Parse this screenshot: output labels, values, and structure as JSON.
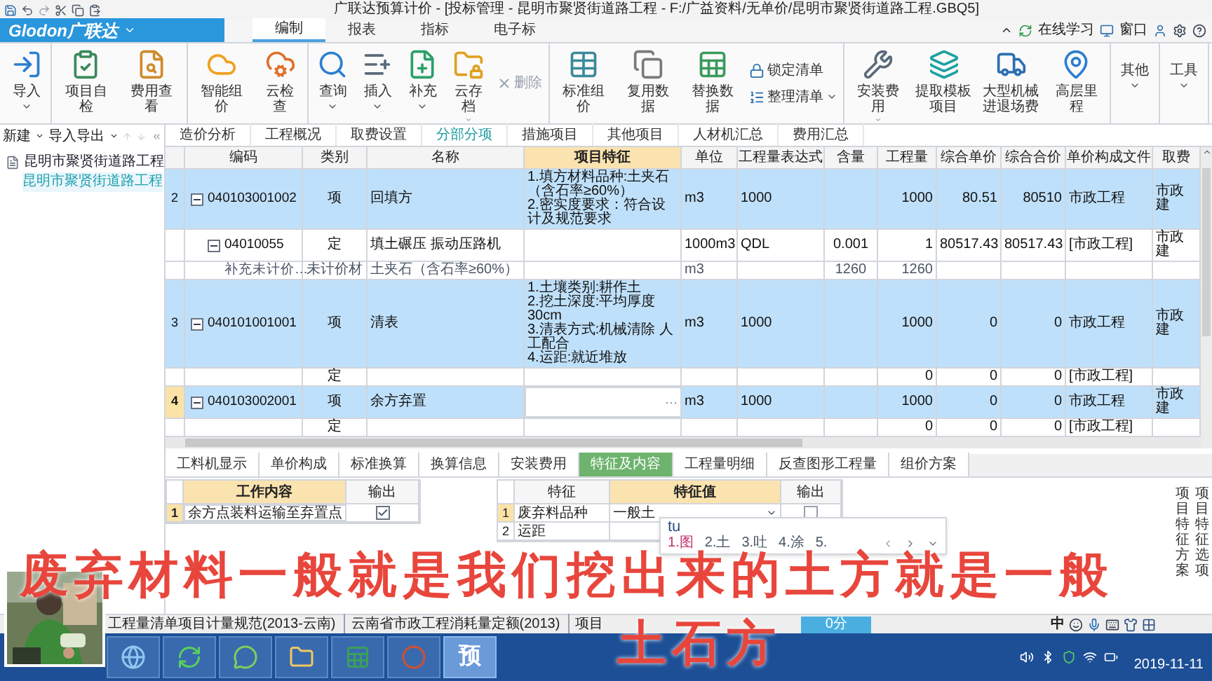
{
  "window": {
    "title": "广联达预算计价 - [投标管理 - 昆明市聚贤街道路工程 - F:/广益资料/无单价/昆明市聚贤街道路工程.GBQ5]"
  },
  "app_menu": {
    "label": "Glodon广联达"
  },
  "ribbon_tabs": [
    {
      "label": "编制",
      "selected": true
    },
    {
      "label": "报表",
      "selected": false
    },
    {
      "label": "指标",
      "selected": false
    },
    {
      "label": "电子标",
      "selected": false
    }
  ],
  "ribbon_links": [
    "在线学习",
    "窗口"
  ],
  "toolbar": [
    {
      "items": [
        {
          "label": "导入",
          "kind": "large",
          "menu": true,
          "disabled": false
        }
      ]
    },
    {
      "items": [
        {
          "label": "项目自检",
          "kind": "large",
          "menu": false,
          "disabled": false
        },
        {
          "label": "费用查看",
          "kind": "large",
          "menu": false,
          "disabled": false
        }
      ]
    },
    {
      "items": [
        {
          "label": "智能组价",
          "kind": "large",
          "menu": false,
          "disabled": false
        },
        {
          "label": "云检查",
          "kind": "large",
          "menu": false,
          "disabled": false
        }
      ]
    },
    {
      "items": [
        {
          "label": "查询",
          "kind": "large",
          "menu": true,
          "disabled": false
        },
        {
          "label": "插入",
          "kind": "large",
          "menu": true,
          "disabled": false
        },
        {
          "label": "补充",
          "kind": "large",
          "menu": true,
          "disabled": false
        },
        {
          "label": "云存档",
          "kind": "large",
          "menu": true,
          "disabled": false
        },
        {
          "label": "删除",
          "kind": "small",
          "menu": false,
          "disabled": true
        }
      ]
    },
    {
      "items": [
        {
          "label": "标准组价",
          "kind": "large",
          "menu": false,
          "disabled": false
        },
        {
          "label": "复用数据",
          "kind": "large",
          "menu": false,
          "disabled": false
        },
        {
          "label": "替换数据",
          "kind": "large",
          "menu": false,
          "disabled": false
        },
        {
          "label": "锁定清单",
          "kind": "small",
          "menu": false,
          "disabled": false
        },
        {
          "label": "整理清单",
          "kind": "small",
          "menu": true,
          "disabled": false
        }
      ]
    },
    {
      "items": [
        {
          "label": "安装费用",
          "kind": "large",
          "menu": true,
          "disabled": false
        },
        {
          "label": "提取模板项目",
          "kind": "large",
          "menu": false,
          "disabled": false
        },
        {
          "label": "大型机械进退场费",
          "kind": "large",
          "menu": false,
          "disabled": false
        },
        {
          "label": "高层里程",
          "kind": "large",
          "menu": false,
          "disabled": false
        }
      ]
    },
    {
      "items": [
        {
          "label": "其他",
          "kind": "large",
          "menu": true,
          "disabled": false
        }
      ]
    },
    {
      "items": [
        {
          "label": "工具",
          "kind": "large",
          "menu": true,
          "disabled": false
        }
      ]
    }
  ],
  "left_panel": {
    "actions": [
      "新建",
      "导入导出"
    ],
    "tree": [
      {
        "label": "昆明市聚贤街道路工程",
        "selected": false,
        "children": [
          {
            "label": "昆明市聚贤街道路工程",
            "selected": true
          }
        ]
      }
    ]
  },
  "view_tabs": [
    {
      "label": "造价分析",
      "selected": false
    },
    {
      "label": "工程概况",
      "selected": false
    },
    {
      "label": "取费设置",
      "selected": false
    },
    {
      "label": "分部分项",
      "selected": true
    },
    {
      "label": "措施项目",
      "selected": false
    },
    {
      "label": "其他项目",
      "selected": false
    },
    {
      "label": "人材机汇总",
      "selected": false
    },
    {
      "label": "费用汇总",
      "selected": false
    }
  ],
  "grid": {
    "columns": [
      {
        "label": "编码",
        "current": false
      },
      {
        "label": "类别",
        "current": false
      },
      {
        "label": "名称",
        "current": false
      },
      {
        "label": "项目特征",
        "current": true
      },
      {
        "label": "单位",
        "current": false
      },
      {
        "label": "工程量表达式",
        "current": false
      },
      {
        "label": "含量",
        "current": false
      },
      {
        "label": "工程量",
        "current": false
      },
      {
        "label": "综合单价",
        "current": false
      },
      {
        "label": "综合合价",
        "current": false
      },
      {
        "label": "单价构成文件",
        "current": false
      },
      {
        "label": "取费",
        "current": false
      }
    ],
    "rows": [
      {
        "kind": "item",
        "row_number": "2",
        "selected": false,
        "expanded": true,
        "code": "040103001002",
        "type": "项",
        "name": "回填方",
        "feature": "1.填方材料品种:土夹石（含石率≥60%）\n2.密实度要求：符合设计及规范要求",
        "unit": "m3",
        "expr": "1000",
        "qty": "1000",
        "unit_price": "80.51",
        "total": "80510",
        "template": "市政工程",
        "fee": "市政建"
      },
      {
        "kind": "quota",
        "selected": false,
        "expanded": true,
        "code": "04010055",
        "type": "定",
        "name": "填土碾压 振动压路机",
        "unit": "1000m3",
        "expr": "QDL",
        "content": "0.001",
        "qty": "1",
        "unit_price": "80517.43",
        "total": "80517.43",
        "template": "[市政工程]",
        "fee": "市政建"
      },
      {
        "kind": "material",
        "selected": false,
        "code": "补充未计价…",
        "type": "未计价材",
        "name": "土夹石（含石率≥60%）",
        "unit": "m3",
        "content": "1260",
        "qty": "1260"
      },
      {
        "kind": "item",
        "row_number": "3",
        "selected": false,
        "expanded": true,
        "code": "040101001001",
        "type": "项",
        "name": "清表",
        "feature": "1.土壤类别:耕作土\n2.挖土深度:平均厚度30cm\n3.清表方式:机械清除 人工配合\n4.运距:就近堆放",
        "unit": "m3",
        "expr": "1000",
        "qty": "1000",
        "unit_price": "0",
        "total": "0",
        "template": "市政工程",
        "fee": "市政建"
      },
      {
        "kind": "quota",
        "selected": false,
        "type": "定",
        "qty": "0",
        "unit_price": "0",
        "total": "0",
        "template": "[市政工程]"
      },
      {
        "kind": "item",
        "row_number": "4",
        "selected": true,
        "expanded": true,
        "code": "040103002001",
        "type": "项",
        "name": "余方弃置",
        "feature_button": "···",
        "unit": "m3",
        "expr": "1000",
        "qty": "1000",
        "unit_price": "0",
        "total": "0",
        "template": "市政工程",
        "fee": "市政建"
      },
      {
        "kind": "quota",
        "selected": false,
        "type": "定",
        "qty": "0",
        "unit_price": "0",
        "total": "0",
        "template": "[市政工程]"
      }
    ]
  },
  "detail_tabs": [
    {
      "label": "工料机显示",
      "selected": false
    },
    {
      "label": "单价构成",
      "selected": false
    },
    {
      "label": "标准换算",
      "selected": false
    },
    {
      "label": "换算信息",
      "selected": false
    },
    {
      "label": "安装费用",
      "selected": false
    },
    {
      "label": "特征及内容",
      "selected": true
    },
    {
      "label": "工程量明细",
      "selected": false
    },
    {
      "label": "反查图形工程量",
      "selected": false
    },
    {
      "label": "组价方案",
      "selected": false
    }
  ],
  "work_content": {
    "columns": [
      {
        "label": "工作内容",
        "current": true
      },
      {
        "label": "输出",
        "current": false
      }
    ],
    "rows": [
      {
        "row_number": "1",
        "content": "余方点装料运输至弃置点",
        "checked": true
      }
    ]
  },
  "features": {
    "columns": [
      {
        "label": "特征",
        "current": false
      },
      {
        "label": "特征值",
        "current": true
      },
      {
        "label": "输出",
        "current": false
      }
    ],
    "rows": [
      {
        "row_number": "1",
        "name": "废弃料品种",
        "value": "一般土",
        "checked": false
      },
      {
        "row_number": "2",
        "name": "运距"
      }
    ]
  },
  "side_tabs": [
    "项目特征方案",
    "项目特征选项"
  ],
  "ime": {
    "input": "tu",
    "candidates": [
      "1.图",
      "2.土",
      "3.吐",
      "4.涂",
      "5."
    ]
  },
  "status_bar": {
    "items": [
      "工程量清单项目计量规范(2013-云南)",
      "云南省市政工程消耗量定额(2013)",
      "项目"
    ],
    "score": "0分"
  },
  "taskbar": {
    "pinned_label": "预",
    "ime_status": "中",
    "date": "2019-11-11"
  },
  "subtitles": [
    "废弃材料一般就是我们挖出来的土方就是一般",
    "土石方"
  ]
}
